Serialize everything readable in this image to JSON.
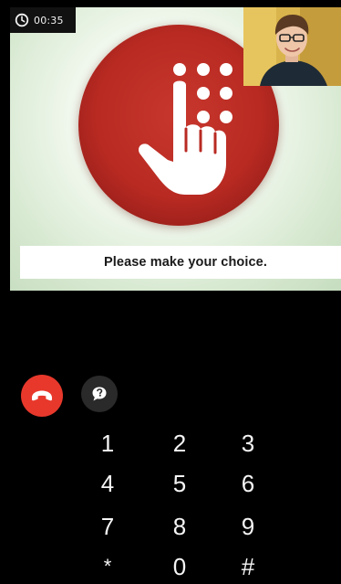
{
  "call": {
    "timer": "00:35",
    "caption": "Please make your choice."
  },
  "icons": {
    "timer": "clock-icon",
    "hangup": "phone-hangup-icon",
    "chat": "chat-bubble-icon",
    "emblem": "keypad-hand-icon"
  },
  "colors": {
    "hangup": "#e8382c",
    "emblem_red": "#b82a22",
    "background": "#000000",
    "video_bg": "#d9ead3"
  },
  "keypad": {
    "rows": [
      [
        "1",
        "2",
        "3"
      ],
      [
        "4",
        "5",
        "6"
      ],
      [
        "7",
        "8",
        "9"
      ],
      [
        "*",
        "0",
        "#"
      ]
    ]
  }
}
